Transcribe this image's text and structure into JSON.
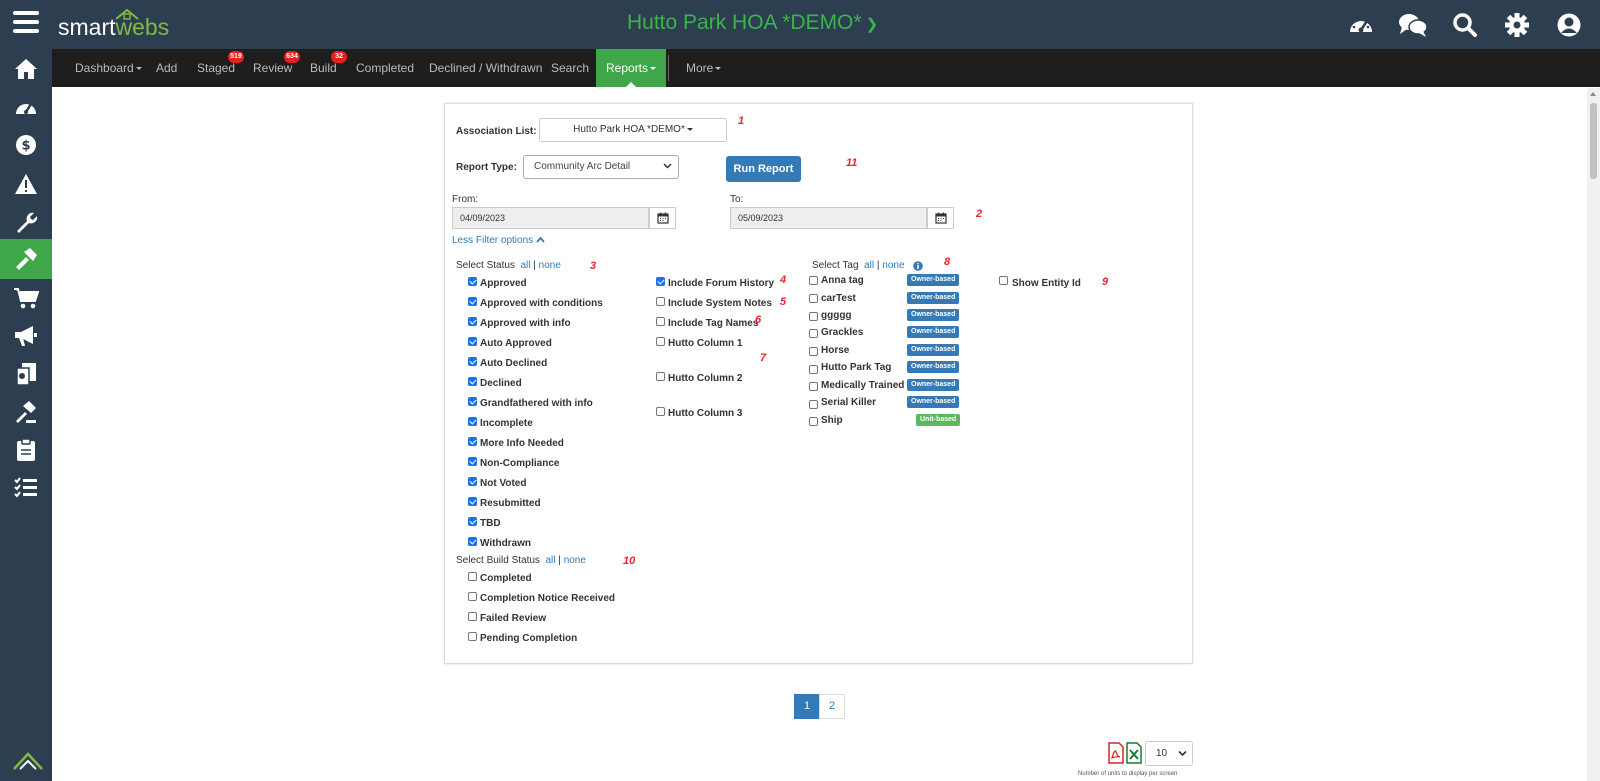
{
  "header": {
    "logo_smart": "smart",
    "logo_webs": "webs",
    "site_title": "Hutto Park HOA *DEMO*",
    "top_icons": [
      "dashboard-gauge-icon",
      "chat-icon",
      "search-icon",
      "settings-gear-icon",
      "user-account-icon"
    ]
  },
  "nav": {
    "items": [
      {
        "label": "Dashboard",
        "dropdown": true
      },
      {
        "label": "Add"
      },
      {
        "label": "Staged",
        "badge": "519"
      },
      {
        "label": "Review",
        "badge": "634"
      },
      {
        "label": "Build",
        "badge": "32"
      },
      {
        "label": "Completed"
      },
      {
        "label": "Declined / Withdrawn"
      },
      {
        "label": "Search"
      },
      {
        "label": "Reports",
        "dropdown": true,
        "active": true
      },
      {
        "label": "More",
        "dropdown": true
      }
    ]
  },
  "sidebar": {
    "icons": [
      "home-icon",
      "gauge-icon",
      "dollar-icon",
      "warning-icon",
      "wrench-icon",
      "hammer-icon",
      "cart-icon",
      "megaphone-icon",
      "documents-icon",
      "gavel-icon",
      "clipboard-icon",
      "checklist-icon"
    ],
    "active_index": 5
  },
  "form": {
    "association_label": "Association List:",
    "association_value": "Hutto Park HOA *DEMO*",
    "report_type_label": "Report Type:",
    "report_type_value": "Community Arc Detail",
    "run_button": "Run Report",
    "from_label": "From:",
    "from_value": "04/09/2023",
    "to_label": "To:",
    "to_value": "05/09/2023",
    "filter_toggle": "Less Filter options",
    "select_status_label": "Select Status",
    "all": "all",
    "sep": "|",
    "none": "none",
    "statuses": [
      {
        "label": "Approved",
        "checked": true
      },
      {
        "label": "Approved with conditions",
        "checked": true
      },
      {
        "label": "Approved with info",
        "checked": true
      },
      {
        "label": "Auto Approved",
        "checked": true
      },
      {
        "label": "Auto Declined",
        "checked": true
      },
      {
        "label": "Declined",
        "checked": true
      },
      {
        "label": "Grandfathered with info",
        "checked": true
      },
      {
        "label": "Incomplete",
        "checked": true
      },
      {
        "label": "More Info Needed",
        "checked": true
      },
      {
        "label": "Non-Compliance",
        "checked": true
      },
      {
        "label": "Not Voted",
        "checked": true
      },
      {
        "label": "Resubmitted",
        "checked": true
      },
      {
        "label": "TBD",
        "checked": true
      },
      {
        "label": "Withdrawn",
        "checked": true
      }
    ],
    "select_build_label": "Select Build Status",
    "build_statuses": [
      {
        "label": "Completed",
        "checked": false
      },
      {
        "label": "Completion Notice Received",
        "checked": false
      },
      {
        "label": "Failed Review",
        "checked": false
      },
      {
        "label": "Pending Completion",
        "checked": false
      }
    ],
    "includes": [
      {
        "label": "Include Forum History",
        "checked": true
      },
      {
        "label": "Include System Notes",
        "checked": false
      },
      {
        "label": "Include Tag Names",
        "checked": false
      },
      {
        "label": "Hutto Column 1",
        "checked": false
      },
      {
        "label": "Hutto Column 2",
        "checked": false
      },
      {
        "label": "Hutto Column 3",
        "checked": false
      }
    ],
    "select_tag_label": "Select Tag",
    "tags": [
      {
        "label": "Anna tag",
        "type": "Owner-based"
      },
      {
        "label": "carTest",
        "type": "Owner-based"
      },
      {
        "label": "ggggg",
        "type": "Owner-based"
      },
      {
        "label": "Grackles",
        "type": "Owner-based"
      },
      {
        "label": "Horse",
        "type": "Owner-based"
      },
      {
        "label": "Hutto Park Tag",
        "type": "Owner-based"
      },
      {
        "label": "Medically Trained",
        "type": "Owner-based"
      },
      {
        "label": "Serial Killer",
        "type": "Owner-based"
      },
      {
        "label": "Ship",
        "type": "Unit-based"
      }
    ],
    "show_entity_label": "Show Entity Id",
    "annotations": [
      "1",
      "2",
      "3",
      "4",
      "5",
      "6",
      "7",
      "8",
      "9",
      "10",
      "11"
    ]
  },
  "pagination": {
    "pages": [
      "1",
      "2"
    ],
    "current": "1"
  },
  "footer": {
    "per_page_value": "10",
    "per_page_note": "Number of units to display per screen",
    "exports": [
      "pdf-export-icon",
      "excel-export-icon"
    ]
  },
  "colors": {
    "accent_green": "#3fa64a",
    "header_bg": "#2c3e50",
    "primary_blue": "#337ab7",
    "annotation_red": "#e8262d"
  }
}
